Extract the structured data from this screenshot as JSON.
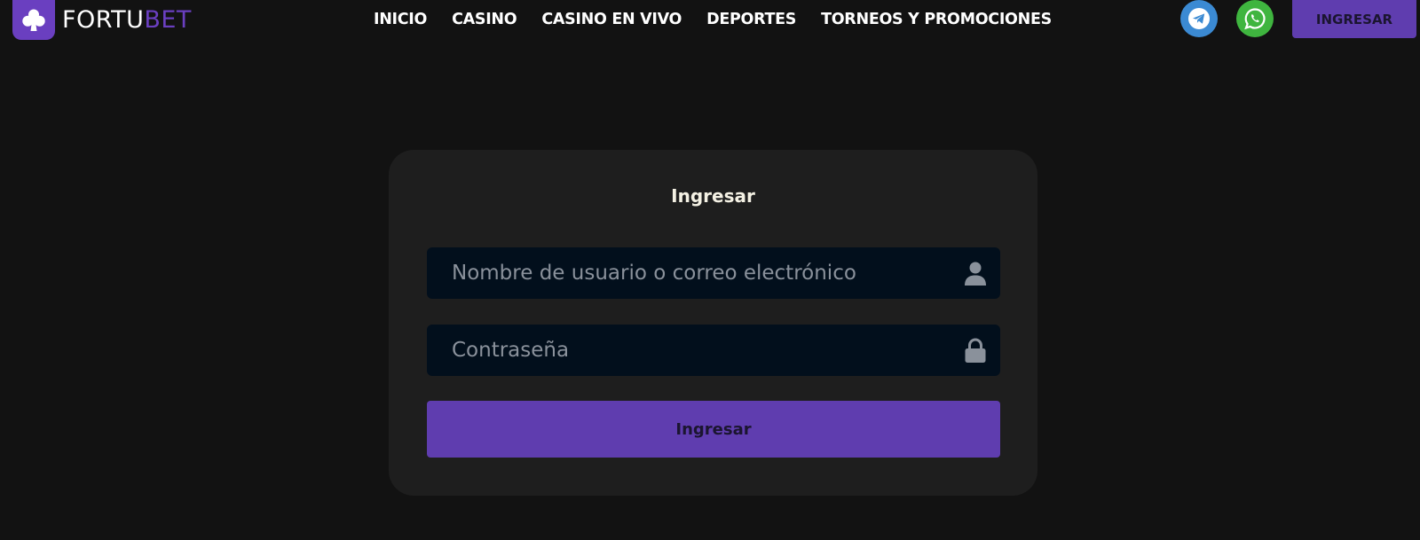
{
  "brand": {
    "name_part1": "FORTU",
    "name_part2": "BET",
    "logo_icon": "club-icon",
    "accent_color": "#6a3fc0"
  },
  "nav": {
    "items": [
      {
        "label": "INICIO"
      },
      {
        "label": "CASINO"
      },
      {
        "label": "CASINO EN VIVO"
      },
      {
        "label": "DEPORTES"
      },
      {
        "label": "TORNEOS Y PROMOCIONES"
      }
    ]
  },
  "social": {
    "telegram": {
      "icon": "telegram-icon",
      "color": "#3b8ad3"
    },
    "whatsapp": {
      "icon": "whatsapp-icon",
      "color": "#3fb53f"
    }
  },
  "header": {
    "login_label": "INGRESAR"
  },
  "login": {
    "title": "Ingresar",
    "username_placeholder": "Nombre de usuario o correo electrónico",
    "username_icon": "user-icon",
    "password_placeholder": "Contraseña",
    "password_icon": "lock-icon",
    "submit_label": "Ingresar"
  }
}
